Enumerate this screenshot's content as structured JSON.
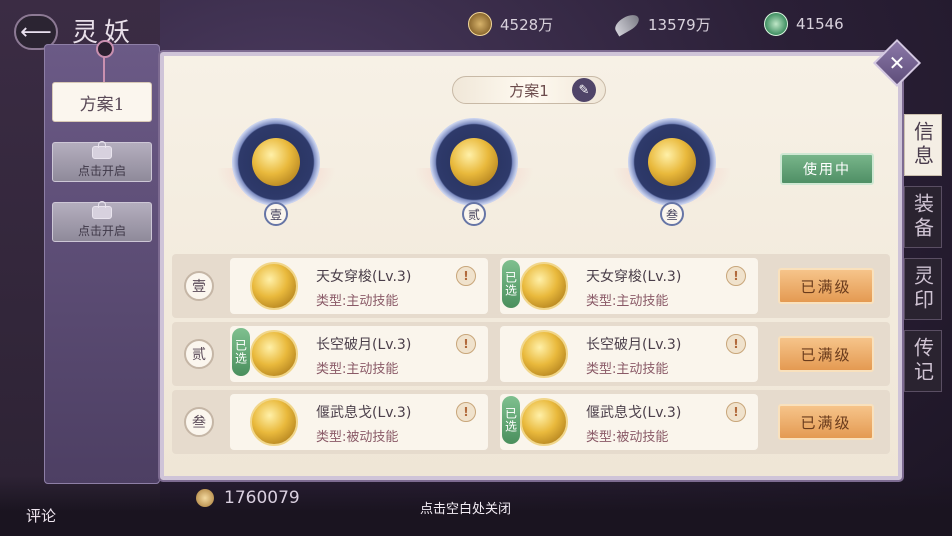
{
  "header": {
    "title": "灵妖",
    "currencies": [
      {
        "icon": "copper-coin-icon",
        "value": "4528万"
      },
      {
        "icon": "feather-icon",
        "value": "13579万"
      },
      {
        "icon": "jade-icon",
        "value": "41546"
      }
    ]
  },
  "plans": [
    {
      "label": "方案1",
      "state": "active"
    },
    {
      "label": "点击开启",
      "state": "locked"
    },
    {
      "label": "点击开启",
      "state": "locked"
    }
  ],
  "main": {
    "plan_name": "方案1",
    "in_use_label": "使用中",
    "slots": [
      "壹",
      "贰",
      "叁"
    ],
    "rows": [
      {
        "num": "壹",
        "left": {
          "name": "天女穿梭",
          "level": "(Lv.3)",
          "type": "类型:主动技能",
          "selected": false
        },
        "right": {
          "name": "天女穿梭",
          "level": "(Lv.3)",
          "type": "类型:主动技能",
          "selected": true
        },
        "button": "已满级"
      },
      {
        "num": "贰",
        "left": {
          "name": "长空破月",
          "level": "(Lv.3)",
          "type": "类型:主动技能",
          "selected": true
        },
        "right": {
          "name": "长空破月",
          "level": "(Lv.3)",
          "type": "类型:主动技能",
          "selected": false
        },
        "button": "已满级"
      },
      {
        "num": "叁",
        "left": {
          "name": "偃武息戈",
          "level": "(Lv.3)",
          "type": "类型:被动技能",
          "selected": false
        },
        "right": {
          "name": "偃武息戈",
          "level": "(Lv.3)",
          "type": "类型:被动技能",
          "selected": true
        },
        "button": "已满级"
      }
    ],
    "selected_badge": "已选"
  },
  "side_tabs": [
    "信息",
    "装备",
    "灵印",
    "传记"
  ],
  "bottom": {
    "resource": "1760079",
    "close_hint": "点击空白处关闭",
    "comment": "评论"
  }
}
